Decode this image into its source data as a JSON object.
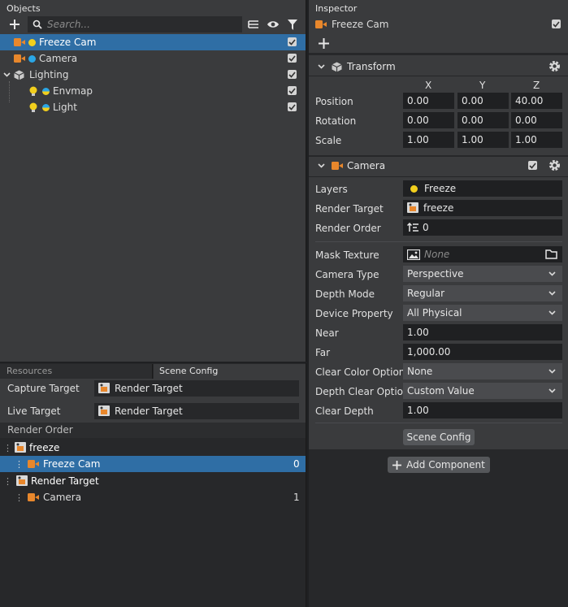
{
  "objects": {
    "title": "Objects",
    "search_placeholder": "Search...",
    "items": [
      {
        "label": "Freeze Cam"
      },
      {
        "label": "Camera"
      },
      {
        "label": "Lighting"
      },
      {
        "label": "Envmap"
      },
      {
        "label": "Light"
      }
    ]
  },
  "bottom_tabs": {
    "resources": "Resources",
    "scene_config": "Scene Config"
  },
  "scene_config": {
    "capture_label": "Capture Target",
    "capture_value": "Render Target",
    "live_label": "Live Target",
    "live_value": "Render Target",
    "render_order_title": "Render Order",
    "groups": [
      {
        "name": "freeze",
        "child": "Freeze Cam",
        "index": "0"
      },
      {
        "name": "Render Target",
        "child": "Camera",
        "index": "1"
      }
    ]
  },
  "inspector": {
    "title": "Inspector",
    "object_name": "Freeze Cam",
    "transform": {
      "title": "Transform",
      "cols": [
        "X",
        "Y",
        "Z"
      ],
      "rows": [
        {
          "label": "Position",
          "x": "0.00",
          "y": "0.00",
          "z": "40.00"
        },
        {
          "label": "Rotation",
          "x": "0.00",
          "y": "0.00",
          "z": "0.00"
        },
        {
          "label": "Scale",
          "x": "1.00",
          "y": "1.00",
          "z": "1.00"
        }
      ]
    },
    "camera": {
      "title": "Camera",
      "layers_label": "Layers",
      "layers_value": "Freeze",
      "render_target_label": "Render Target",
      "render_target_value": "freeze",
      "render_order_label": "Render Order",
      "render_order_value": "0",
      "mask_texture_label": "Mask Texture",
      "mask_texture_value": "None",
      "camera_type_label": "Camera Type",
      "camera_type_value": "Perspective",
      "depth_mode_label": "Depth Mode",
      "depth_mode_value": "Regular",
      "device_property_label": "Device Property",
      "device_property_value": "All Physical",
      "near_label": "Near",
      "near_value": "1.00",
      "far_label": "Far",
      "far_value": "1,000.00",
      "clear_color_label": "Clear Color Option",
      "clear_color_value": "None",
      "depth_clear_label": "Depth Clear Option",
      "depth_clear_value": "Custom Value",
      "clear_depth_label": "Clear Depth",
      "clear_depth_value": "1.00",
      "scene_config_button": "Scene Config"
    },
    "add_component": "Add Component"
  },
  "colors": {
    "accent": "#2f6ea5",
    "orange": "#e8872c",
    "yellow": "#f2cf1d",
    "blue": "#2aa6e6"
  }
}
